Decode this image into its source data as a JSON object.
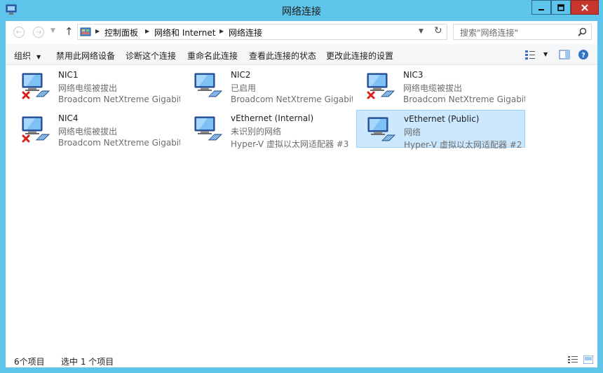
{
  "window": {
    "title": "网络连接"
  },
  "address_bar": {
    "crumbs": [
      "控制面板",
      "网络和 Internet",
      "网络连接"
    ]
  },
  "search": {
    "placeholder": "搜索\"网络连接\""
  },
  "commands": [
    {
      "label": "组织"
    },
    {
      "label": "禁用此网络设备"
    },
    {
      "label": "诊断这个连接"
    },
    {
      "label": "重命名此连接"
    },
    {
      "label": "查看此连接的状态"
    },
    {
      "label": "更改此连接的设置"
    }
  ],
  "connections": [
    {
      "name": "NIC1",
      "status": "网络电缆被拔出",
      "device": "Broadcom NetXtreme Gigabit ...",
      "disconnected": true
    },
    {
      "name": "NIC2",
      "status": "已启用",
      "device": "Broadcom NetXtreme Gigabit ...",
      "disconnected": false
    },
    {
      "name": "NIC3",
      "status": "网络电缆被拔出",
      "device": "Broadcom NetXtreme Gigabit ...",
      "disconnected": true
    },
    {
      "name": "NIC4",
      "status": "网络电缆被拔出",
      "device": "Broadcom NetXtreme Gigabit ...",
      "disconnected": true
    },
    {
      "name": "vEthernet (Internal)",
      "status": "未识别的网络",
      "device": "Hyper-V 虚拟以太网适配器 #3",
      "disconnected": false
    },
    {
      "name": "vEthernet (Public)",
      "status": "网络",
      "device": "Hyper-V 虚拟以太网适配器 #2",
      "disconnected": false,
      "selected": true
    }
  ],
  "status_bar": {
    "item_count": "6个项目",
    "selected_count": "选中 1 个项目"
  },
  "colors": {
    "frame": "#5ec4ea",
    "close": "#c7372d",
    "selection": "#cce8ff",
    "selection_border": "#99d1ff"
  }
}
